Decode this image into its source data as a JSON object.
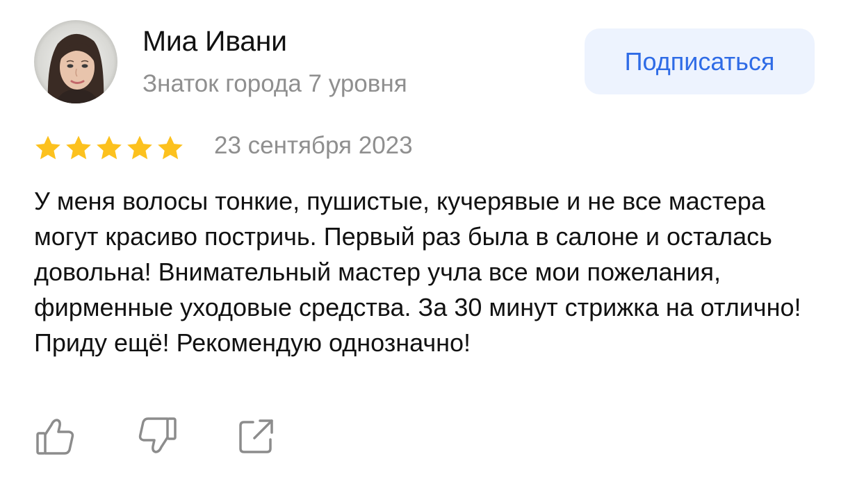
{
  "author": {
    "name": "Миа Ивани",
    "level": "Знаток города 7 уровня",
    "avatar_icon": "user-photo"
  },
  "subscribe_label": "Подписаться",
  "review": {
    "rating": 5,
    "rating_max": 5,
    "date": "23 сентября 2023",
    "text": "У меня волосы тонкие, пушистые, кучерявые и не все мастера могут красиво постричь. Первый раз была в салоне и осталась довольна! Внимательный мастер учла все мои пожелания, фирменные уходовые средства. За 30 минут стрижка на отлично! Приду ещё! Рекомендую однозначно!"
  },
  "actions": {
    "like_icon": "thumbs-up",
    "dislike_icon": "thumbs-down",
    "share_icon": "share"
  },
  "colors": {
    "star": "#fcc11e",
    "subscribe_bg": "#edf3fe",
    "subscribe_text": "#2e6be6",
    "secondary_text": "#8f8f8f",
    "icon": "#8c8c8c"
  }
}
